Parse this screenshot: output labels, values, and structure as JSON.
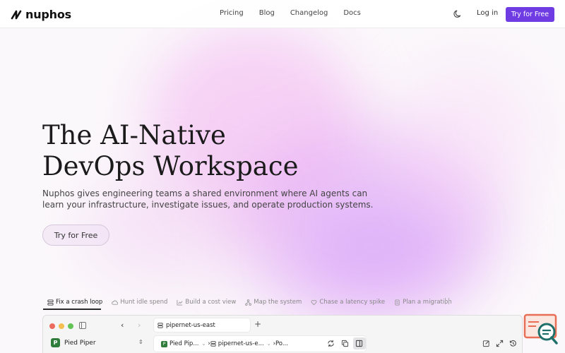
{
  "brand": {
    "name": "nuphos"
  },
  "nav": {
    "items": [
      "Pricing",
      "Blog",
      "Changelog",
      "Docs"
    ]
  },
  "header": {
    "login": "Log in",
    "cta": "Try for Free"
  },
  "hero": {
    "title_line1": "The AI-Native",
    "title_line2": "DevOps Workspace",
    "subtitle": "Nuphos gives engineering teams a shared environment where AI agents can learn your infrastructure, investigate issues, and operate production systems.",
    "cta": "Try for Free"
  },
  "demo_tabs": [
    {
      "label": "Fix a crash loop",
      "icon": "layers-icon"
    },
    {
      "label": "Hunt idle spend",
      "icon": "cloud-icon"
    },
    {
      "label": "Build a cost view",
      "icon": "chart-icon"
    },
    {
      "label": "Map the system",
      "icon": "network-icon"
    },
    {
      "label": "Chase a latency spike",
      "icon": "heart-icon"
    },
    {
      "label": "Plan a migration",
      "icon": "document-icon"
    }
  ],
  "app": {
    "tab_title": "pipernet-us-east",
    "org": "Pied Piper",
    "org_initial": "P",
    "breadcrumb": [
      "Pied Pip...",
      "pipernet-us-e...",
      "Po..."
    ]
  },
  "colors": {
    "accent": "#6f3be3",
    "org_badge": "#2f7d3a"
  }
}
